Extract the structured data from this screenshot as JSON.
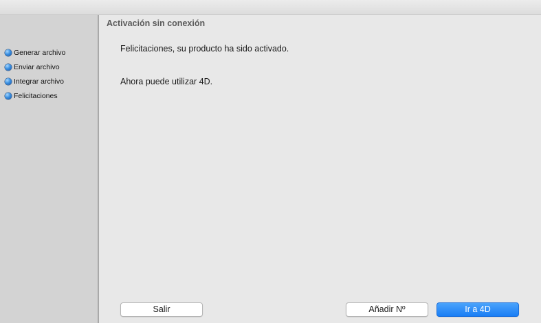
{
  "sidebar": {
    "steps": [
      {
        "label": "Generar archivo"
      },
      {
        "label": "Enviar archivo"
      },
      {
        "label": "Integrar archivo"
      },
      {
        "label": "Felicitaciones"
      }
    ]
  },
  "main": {
    "section_title": "Activación sin conexión",
    "message_success": "Felicitaciones, su producto ha sido activado.",
    "message_next": "Ahora puede utilizar 4D."
  },
  "buttons": {
    "exit_label": "Salir",
    "add_number_label": "Añadir Nº",
    "go_4d_label": "Ir a 4D"
  },
  "colors": {
    "primary_button": "#1a7ef5",
    "step_bullet": "#3a8fe0"
  }
}
